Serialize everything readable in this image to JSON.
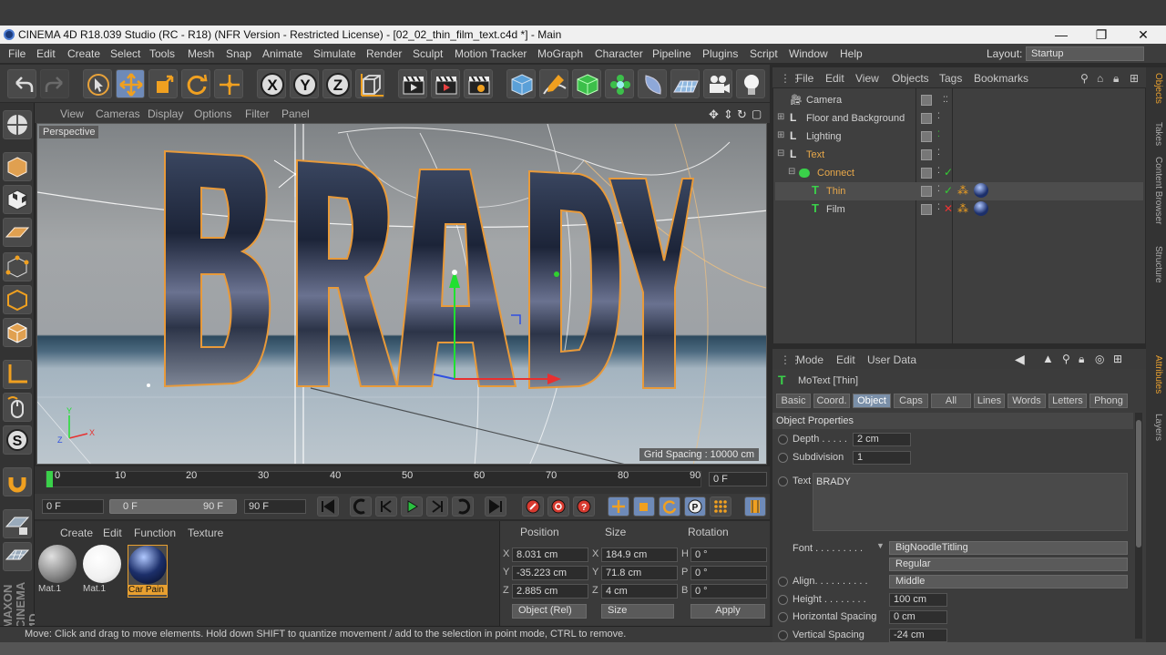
{
  "window": {
    "title": "CINEMA 4D R18.039 Studio (RC - R18) (NFR Version - Restricted License) - [02_02_thin_film_text.c4d *] - Main",
    "minimize": "—",
    "maximize": "❐",
    "close": "✕"
  },
  "menubar": {
    "items": [
      "File",
      "Edit",
      "Create",
      "Select",
      "Tools",
      "Mesh",
      "Snap",
      "Animate",
      "Simulate",
      "Render",
      "Sculpt",
      "Motion Tracker",
      "MoGraph",
      "Character",
      "Pipeline",
      "Plugins",
      "Script",
      "Window",
      "Help"
    ],
    "layout_label": "Layout:",
    "layout_value": "Startup"
  },
  "viewport": {
    "menu": [
      "View",
      "Cameras",
      "Display",
      "Options",
      "Filter",
      "Panel"
    ],
    "label": "Perspective",
    "grid_spacing": "Grid Spacing : 10000 cm",
    "text_3d": "BRADY"
  },
  "timeline": {
    "ticks": [
      "0",
      "10",
      "20",
      "30",
      "40",
      "50",
      "60",
      "70",
      "80",
      "90"
    ],
    "current_frame": "0 F",
    "start_field": "0 F",
    "range_start": "0 F",
    "range_end": "90 F",
    "end_field": "90 F"
  },
  "material_manager": {
    "menu": [
      "Create",
      "Edit",
      "Function",
      "Texture"
    ],
    "materials": [
      {
        "name": "Mat.1",
        "color": "#9a9a9a"
      },
      {
        "name": "Mat.1",
        "color": "#f4f4f4"
      },
      {
        "name": "Car Pain",
        "color": "#1c2f6a"
      }
    ]
  },
  "coordinates": {
    "headers": {
      "position": "Position",
      "size": "Size",
      "rotation": "Rotation"
    },
    "rows": [
      {
        "pos_axis": "X",
        "pos": "8.031 cm",
        "size_axis": "X",
        "size": "184.9 cm",
        "rot_axis": "H",
        "rot": "0 °"
      },
      {
        "pos_axis": "Y",
        "pos": "-35.223 cm",
        "size_axis": "Y",
        "size": "71.8 cm",
        "rot_axis": "P",
        "rot": "0 °"
      },
      {
        "pos_axis": "Z",
        "pos": "2.885 cm",
        "size_axis": "Z",
        "size": "4 cm",
        "rot_axis": "B",
        "rot": "0 °"
      }
    ],
    "mode": "Object (Rel)",
    "size_mode": "Size",
    "apply": "Apply"
  },
  "object_manager": {
    "menu": [
      "File",
      "Edit",
      "View",
      "Objects",
      "Tags",
      "Bookmarks"
    ],
    "objects": [
      {
        "name": "Camera"
      },
      {
        "name": "Floor and Background"
      },
      {
        "name": "Lighting"
      },
      {
        "name": "Text"
      },
      {
        "name": "Connect"
      },
      {
        "name": "Thin"
      },
      {
        "name": "Film"
      }
    ]
  },
  "attributes": {
    "menu": [
      "Mode",
      "Edit",
      "User Data"
    ],
    "object_title": "MoText [Thin]",
    "tabs": [
      "Basic",
      "Coord.",
      "Object",
      "Caps",
      "All",
      "Lines",
      "Words",
      "Letters",
      "Phong"
    ],
    "section": "Object Properties",
    "depth_label": "Depth . . . . .",
    "depth": "2 cm",
    "subdivision_label": "Subdivision",
    "subdivision": "1",
    "text_label": "Text",
    "text_value": "BRADY",
    "font_label": "Font . . . . . . . . .",
    "font": "BigNoodleTitling",
    "font_style": "Regular",
    "align_label": "Align. . . . . . . . . .",
    "align": "Middle",
    "height_label": "Height . . . . . . . .",
    "height": "100 cm",
    "hspacing_label": "Horizontal Spacing",
    "hspacing": "0 cm",
    "vspacing_label": "Vertical Spacing",
    "vspacing": "-24 cm"
  },
  "right_tabs": [
    "Objects",
    "Takes",
    "Content Browser",
    "Structure",
    "Attributes",
    "Layers"
  ],
  "status": "Move: Click and drag to move elements. Hold down SHIFT to quantize movement / add to the selection in point mode, CTRL to remove.",
  "brand": "MAXON CINEMA 4D"
}
